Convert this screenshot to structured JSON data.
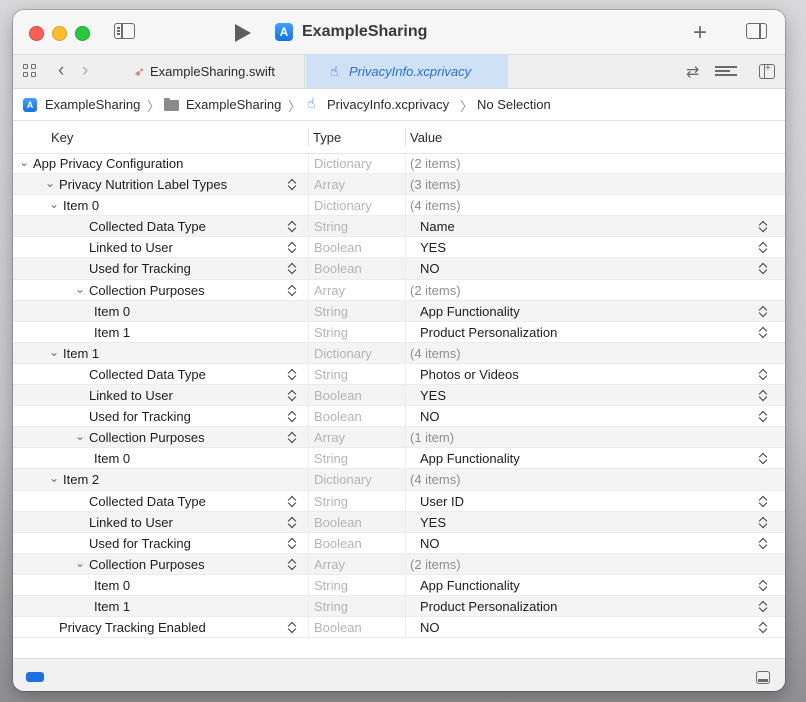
{
  "titlebar": {
    "scheme_title": "ExampleSharing",
    "play_icon": "play-icon",
    "plus_label": "+"
  },
  "tabs": [
    {
      "label": "ExampleSharing.swift",
      "icon": "swift-icon",
      "active": false
    },
    {
      "label": "PrivacyInfo.xcprivacy",
      "icon": "hand-icon",
      "active": true
    }
  ],
  "breadcrumb": {
    "items": [
      "ExampleSharing",
      "ExampleSharing",
      "PrivacyInfo.xcprivacy",
      "No Selection"
    ],
    "separator": "〉"
  },
  "editor": {
    "columns": {
      "key": "Key",
      "type": "Type",
      "value": "Value"
    },
    "rows": [
      {
        "key": "App Privacy Configuration",
        "type": "Dictionary",
        "value": "(2 items)"
      },
      {
        "key": "Privacy Nutrition Label Types",
        "type": "Array",
        "value": "(3 items)"
      },
      {
        "key": "Item 0",
        "type": "Dictionary",
        "value": "(4 items)"
      },
      {
        "key": "Collected Data Type",
        "type": "String",
        "value": "Name"
      },
      {
        "key": "Linked to User",
        "type": "Boolean",
        "value": "YES"
      },
      {
        "key": "Used for Tracking",
        "type": "Boolean",
        "value": "NO"
      },
      {
        "key": "Collection Purposes",
        "type": "Array",
        "value": "(2 items)"
      },
      {
        "key": "Item 0",
        "type": "String",
        "value": "App Functionality"
      },
      {
        "key": "Item 1",
        "type": "String",
        "value": "Product Personalization"
      },
      {
        "key": "Item 1",
        "type": "Dictionary",
        "value": "(4 items)"
      },
      {
        "key": "Collected Data Type",
        "type": "String",
        "value": "Photos or Videos"
      },
      {
        "key": "Linked to User",
        "type": "Boolean",
        "value": "YES"
      },
      {
        "key": "Used for Tracking",
        "type": "Boolean",
        "value": "NO"
      },
      {
        "key": "Collection Purposes",
        "type": "Array",
        "value": "(1 item)"
      },
      {
        "key": "Item 0",
        "type": "String",
        "value": "App Functionality"
      },
      {
        "key": "Item 2",
        "type": "Dictionary",
        "value": "(4 items)"
      },
      {
        "key": "Collected Data Type",
        "type": "String",
        "value": "User ID"
      },
      {
        "key": "Linked to User",
        "type": "Boolean",
        "value": "YES"
      },
      {
        "key": "Used for Tracking",
        "type": "Boolean",
        "value": "NO"
      },
      {
        "key": "Collection Purposes",
        "type": "Array",
        "value": "(2 items)"
      },
      {
        "key": "Item 0",
        "type": "String",
        "value": "App Functionality"
      },
      {
        "key": "Item 1",
        "type": "String",
        "value": "Product Personalization"
      },
      {
        "key": "Privacy Tracking Enabled",
        "type": "Boolean",
        "value": "NO"
      }
    ]
  },
  "colors": {
    "active_tab_bg": "#cfe2f5",
    "active_tab_text": "#2a6fd6",
    "debug_indicator": "#1e6fe0"
  }
}
